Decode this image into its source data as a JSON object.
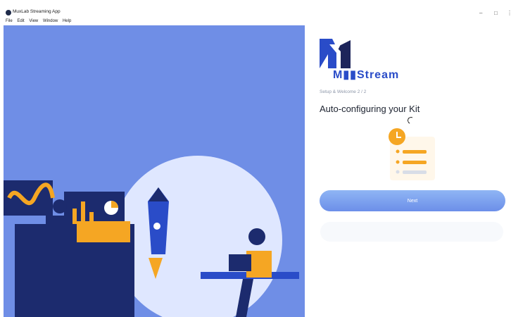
{
  "window": {
    "title": "MuxLab Streaming App",
    "menu": [
      "File",
      "Edit",
      "View",
      "Window",
      "Help"
    ],
    "controls": [
      "–",
      "□",
      "⋮"
    ]
  },
  "brand": {
    "logo_text": "M▮▮Stream"
  },
  "setup": {
    "step_text": "Setup & Welcome 2 / 2",
    "heading": "Auto-configuring your Kit",
    "next_label": "Next"
  },
  "colors": {
    "art_background": "#6f8ee6",
    "primary": "#6c8fe9",
    "brand": "#2a4cc8",
    "accent": "#f5a623"
  }
}
